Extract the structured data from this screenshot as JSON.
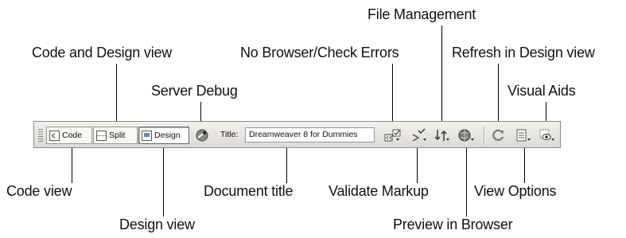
{
  "callouts": {
    "file_management": "File Management",
    "code_and_design_view": "Code and Design view",
    "no_browser_check_errors": "No Browser/Check Errors",
    "refresh_in_design_view": "Refresh in Design view",
    "server_debug": "Server Debug",
    "visual_aids": "Visual Aids",
    "code_view": "Code view",
    "document_title": "Document title",
    "validate_markup": "Validate Markup",
    "view_options": "View Options",
    "design_view": "Design view",
    "preview_in_browser": "Preview in Browser"
  },
  "toolbar": {
    "code_label": "Code",
    "split_label": "Split",
    "design_label": "Design",
    "active_view": "Design",
    "title_label": "Title:",
    "title_value": "Dreamweaver 8 for Dummies"
  },
  "icons": [
    "server-debug-icon",
    "no-browser-check-errors-icon",
    "validate-markup-icon",
    "file-management-icon",
    "preview-in-browser-icon",
    "refresh-icon",
    "view-options-icon",
    "visual-aids-icon"
  ]
}
